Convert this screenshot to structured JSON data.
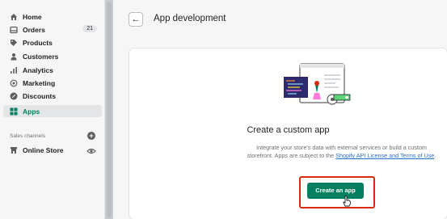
{
  "sidebar": {
    "items": [
      {
        "label": "Home",
        "icon": "home-icon"
      },
      {
        "label": "Orders",
        "icon": "orders-icon",
        "badge": "21"
      },
      {
        "label": "Products",
        "icon": "tag-icon"
      },
      {
        "label": "Customers",
        "icon": "person-icon"
      },
      {
        "label": "Analytics",
        "icon": "bar-chart-icon"
      },
      {
        "label": "Marketing",
        "icon": "target-icon"
      },
      {
        "label": "Discounts",
        "icon": "discount-icon"
      },
      {
        "label": "Apps",
        "icon": "apps-icon",
        "active": true
      }
    ],
    "sales_channels_label": "Sales channels",
    "online_store_label": "Online Store"
  },
  "header": {
    "title": "App development"
  },
  "card": {
    "title": "Create a custom app",
    "description_prefix": "Integrate your store's data with external services or build a custom storefront. Apps are subject to the ",
    "link_text": "Shopify API License and Terms of Use",
    "description_suffix": ".",
    "button_label": "Create an app"
  },
  "colors": {
    "accent": "#008060",
    "highlight": "#d72c0d",
    "link": "#2c6ecb"
  }
}
